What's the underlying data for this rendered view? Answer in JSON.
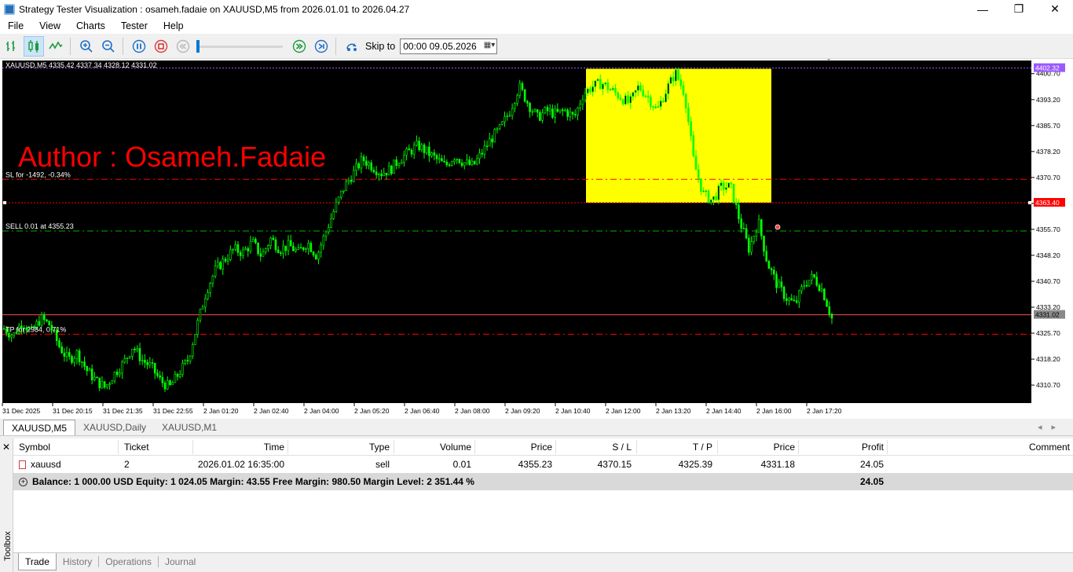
{
  "window": {
    "title": "Strategy Tester Visualization : osameh.fadaie on XAUUSD,M5 from 2026.01.01 to 2026.04.27",
    "minimize": "—",
    "maximize": "❐",
    "close": "✕"
  },
  "menu": [
    "File",
    "View",
    "Charts",
    "Tester",
    "Help"
  ],
  "toolbar": {
    "skip_to_label": "Skip to",
    "skip_to_value": "00:00 09.05.2026"
  },
  "chart": {
    "header": "XAUUSD,M5  4335.42 4337.34 4328.12 4331.02",
    "watermark": "Author : Osameh.Fadaie",
    "sl_label": "SL for -1492, -0.34%",
    "sell_label": "SELL 0.01 at 4355.23",
    "tp_label": "TP for 2984, 0.71%",
    "price_ticks": [
      "4400.70",
      "4393.20",
      "4385.70",
      "4378.20",
      "4370.70",
      "4363.20",
      "4355.70",
      "4348.20",
      "4340.70",
      "4333.20",
      "4325.70",
      "4318.20",
      "4310.70"
    ],
    "time_ticks": [
      "31 Dec 2025",
      "31 Dec 20:15",
      "31 Dec 21:35",
      "31 Dec 22:55",
      "2 Jan 01:20",
      "2 Jan 02:40",
      "2 Jan 04:00",
      "2 Jan 05:20",
      "2 Jan 06:40",
      "2 Jan 08:00",
      "2 Jan 09:20",
      "2 Jan 10:40",
      "2 Jan 12:00",
      "2 Jan 13:20",
      "2 Jan 14:40",
      "2 Jan 16:00",
      "2 Jan 17:20"
    ],
    "tag_top": "4402.32",
    "tag_red": "4363.40",
    "tag_bid": "4331.02",
    "colors": {
      "background": "#000000",
      "candles": "#00ff00",
      "highlight": "#ffff00",
      "sl_line": "#ff0000",
      "sell_line": "#00b000",
      "bid_line": "#ff5050",
      "watermark": "#ff0000"
    }
  },
  "chart_data": {
    "type": "candlestick",
    "symbol": "XAUUSD",
    "timeframe": "M5",
    "ylim": [
      4305.5,
      4404.5
    ],
    "levels": {
      "stop_loss": 4370.15,
      "entry": 4355.23,
      "take_profit": 4325.39,
      "bid": 4331.02,
      "upper_dotted": 4402.32,
      "red_tag": 4363.4
    },
    "close_series": [
      4327,
      4325,
      4329,
      4326,
      4330,
      4328,
      4322,
      4318,
      4320,
      4315,
      4312,
      4310,
      4314,
      4317,
      4322,
      4318,
      4316,
      4312,
      4310,
      4314,
      4318,
      4328,
      4338,
      4344,
      4347,
      4350,
      4349,
      4352,
      4348,
      4353,
      4350,
      4351,
      4349,
      4352,
      4348,
      4355,
      4362,
      4368,
      4372,
      4376,
      4374,
      4372,
      4373,
      4376,
      4378,
      4380,
      4378,
      4376,
      4374,
      4377,
      4375,
      4374,
      4378,
      4382,
      4385,
      4390,
      4397,
      4392,
      4388,
      4390,
      4389,
      4390,
      4388,
      4395,
      4397,
      4398,
      4396,
      4394,
      4392,
      4397,
      4394,
      4390,
      4396,
      4401,
      4395,
      4375,
      4366,
      4364,
      4368,
      4368,
      4358,
      4350,
      4358,
      4346,
      4340,
      4336,
      4334,
      4340,
      4342,
      4338,
      4330
    ]
  },
  "chart_tabs": [
    "XAUUSD,M5",
    "XAUUSD,Daily",
    "XAUUSD,M1"
  ],
  "toolbox": {
    "side_label": "Toolbox",
    "close": "✕",
    "columns": [
      "Symbol",
      "Ticket",
      "Time",
      "Type",
      "Volume",
      "Price",
      "S / L",
      "T / P",
      "Price",
      "Profit",
      "Comment"
    ],
    "rows": [
      {
        "symbol": "xauusd",
        "ticket": "2",
        "time": "2026.01.02 16:35:00",
        "type": "sell",
        "volume": "0.01",
        "price": "4355.23",
        "sl": "4370.15",
        "tp": "4325.39",
        "price_now": "4331.18",
        "profit": "24.05",
        "comment": ""
      }
    ],
    "balance_text": "Balance: 1 000.00 USD  Equity: 1 024.05  Margin: 43.55  Free Margin: 980.50  Margin Level: 2 351.44 %",
    "balance_profit": "24.05",
    "tabs": [
      "Trade",
      "History",
      "Operations",
      "Journal"
    ]
  }
}
